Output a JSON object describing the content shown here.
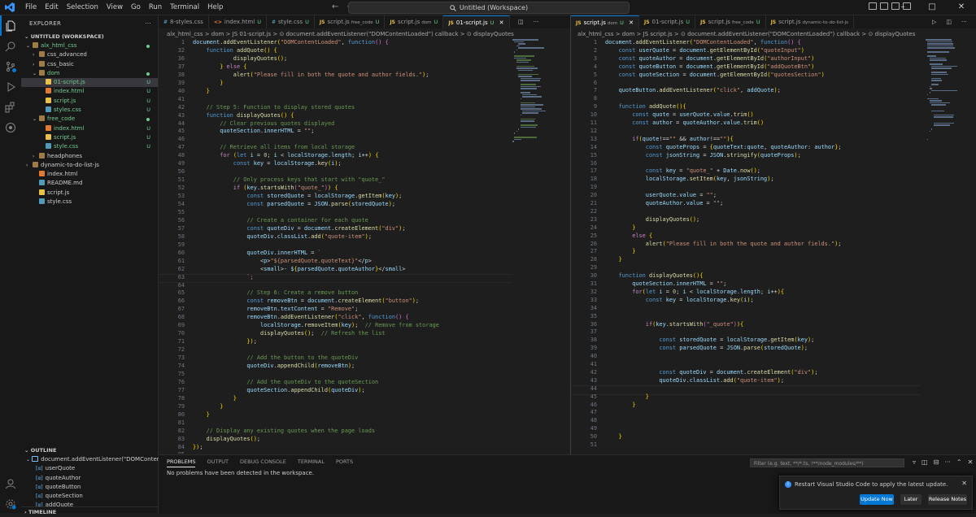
{
  "menu": [
    "File",
    "Edit",
    "Selection",
    "View",
    "Go",
    "Run",
    "Terminal",
    "Help"
  ],
  "search": {
    "text": "Untitled (Workspace)"
  },
  "explorer": {
    "title": "EXPLORER",
    "workspace": "UNTITLED (WORKSPACE)"
  },
  "tree": [
    {
      "label": "alx_html_css",
      "depth": 0,
      "kind": "folder-open",
      "status": "dot"
    },
    {
      "label": "css_advanced",
      "depth": 1,
      "kind": "folder",
      "status": ""
    },
    {
      "label": "css_basic",
      "depth": 1,
      "kind": "folder",
      "status": ""
    },
    {
      "label": "dom",
      "depth": 1,
      "kind": "folder-open",
      "status": "dot"
    },
    {
      "label": "01-script.js",
      "depth": 2,
      "kind": "js",
      "status": "U",
      "selected": true
    },
    {
      "label": "index.html",
      "depth": 2,
      "kind": "html",
      "status": "U"
    },
    {
      "label": "script.js",
      "depth": 2,
      "kind": "js",
      "status": "U"
    },
    {
      "label": "styles.css",
      "depth": 2,
      "kind": "css",
      "status": "U"
    },
    {
      "label": "free_code",
      "depth": 1,
      "kind": "folder-open",
      "status": "dot"
    },
    {
      "label": "index.html",
      "depth": 2,
      "kind": "html",
      "status": "U"
    },
    {
      "label": "script.js",
      "depth": 2,
      "kind": "js",
      "status": "U"
    },
    {
      "label": "style.css",
      "depth": 2,
      "kind": "css",
      "status": "U"
    },
    {
      "label": "headphones",
      "depth": 1,
      "kind": "folder",
      "status": ""
    },
    {
      "label": "dynamic-to-do-list-js",
      "depth": 0,
      "kind": "folder",
      "status": ""
    },
    {
      "label": "index.html",
      "depth": 1,
      "kind": "html",
      "status": ""
    },
    {
      "label": "README.md",
      "depth": 1,
      "kind": "md",
      "status": ""
    },
    {
      "label": "script.js",
      "depth": 1,
      "kind": "js",
      "status": ""
    },
    {
      "label": "style.css",
      "depth": 1,
      "kind": "css",
      "status": ""
    }
  ],
  "outline": {
    "title": "OUTLINE",
    "root": "document.addEventListener(\"DOMContentLoa...",
    "items": [
      "userQuote",
      "quoteAuthor",
      "quoteButton",
      "quoteSection",
      "addQuote"
    ]
  },
  "timeline": {
    "title": "TIMELINE"
  },
  "left_tabs": [
    {
      "icon": "#",
      "name": "8-styles.css",
      "dir": "",
      "status": ""
    },
    {
      "icon": "<>",
      "name": "index.html",
      "dir": "",
      "status": "U"
    },
    {
      "icon": "#",
      "name": "style.css",
      "dir": "",
      "status": "U"
    },
    {
      "icon": "JS",
      "name": "script.js",
      "dir": "free_code",
      "status": "U"
    },
    {
      "icon": "JS",
      "name": "script.js",
      "dir": "dom",
      "status": "U"
    },
    {
      "icon": "JS",
      "name": "01-script.js",
      "dir": "",
      "status": "U",
      "active": true
    }
  ],
  "right_tabs": [
    {
      "icon": "JS",
      "name": "script.js",
      "dir": "dom",
      "status": "U",
      "active": true
    },
    {
      "icon": "JS",
      "name": "01-script.js",
      "dir": "",
      "status": "U"
    },
    {
      "icon": "JS",
      "name": "script.js",
      "dir": "free_code",
      "status": "U"
    },
    {
      "icon": "JS",
      "name": "script.js",
      "dir": "dynamic-to-do-list-js",
      "status": ""
    }
  ],
  "left_crumbs": "alx_html_css > dom > JS 01-script.js > ⊙ document.addEventListener(\"DOMContentLoaded\") callback > ⊙ displayQuotes",
  "right_crumbs": "alx_html_css > dom > JS script.js > ⊙ document.addEventListener(\"DOMContentLoaded\") callback > ⊙ displayQuotes",
  "left_code": [
    [
      "1",
      "document.addEventListener(\"DOMContentLoaded\", function() {"
    ],
    [
      "32",
      "    function addQuote() {"
    ],
    [
      "36",
      "            displayQuotes();"
    ],
    [
      "37",
      "        } else {"
    ],
    [
      "38",
      "            alert(\"Please fill in both the quote and author fields.\");"
    ],
    [
      "39",
      "        }"
    ],
    [
      "40",
      "    }"
    ],
    [
      "41",
      ""
    ],
    [
      "42",
      "    // Step 5: Function to display stored quotes"
    ],
    [
      "43",
      "    function displayQuotes() {"
    ],
    [
      "44",
      "        // Clear previous quotes displayed"
    ],
    [
      "45",
      "        quoteSection.innerHTML = \"\";"
    ],
    [
      "46",
      ""
    ],
    [
      "47",
      "        // Retrieve all items from local storage"
    ],
    [
      "48",
      "        for (let i = 0; i < localStorage.length; i++) {"
    ],
    [
      "49",
      "            const key = localStorage.key(i);"
    ],
    [
      "50",
      ""
    ],
    [
      "51",
      "            // Only process keys that start with \"quote_\""
    ],
    [
      "52",
      "            if (key.startsWith(\"quote_\")) {"
    ],
    [
      "53",
      "                const storedQuote = localStorage.getItem(key);"
    ],
    [
      "54",
      "                const parsedQuote = JSON.parse(storedQuote);"
    ],
    [
      "55",
      ""
    ],
    [
      "56",
      "                // Create a container for each quote"
    ],
    [
      "57",
      "                const quoteDiv = document.createElement(\"div\");"
    ],
    [
      "58",
      "                quoteDiv.classList.add(\"quote-item\");"
    ],
    [
      "59",
      ""
    ],
    [
      "60",
      "                quoteDiv.innerHTML = `"
    ],
    [
      "61",
      "                    <p>\"${parsedQuote.quoteText}\"</p>"
    ],
    [
      "62",
      "                    <small>- ${parsedQuote.quoteAuthor}</small>"
    ],
    [
      "63",
      "                `;"
    ],
    [
      "64",
      ""
    ],
    [
      "65",
      "                // Step 6: Create a remove button"
    ],
    [
      "66",
      "                const removeBtn = document.createElement(\"button\");"
    ],
    [
      "67",
      "                removeBtn.textContent = \"Remove\";"
    ],
    [
      "68",
      "                removeBtn.addEventListener(\"click\", function() {"
    ],
    [
      "69",
      "                    localStorage.removeItem(key);  // Remove from storage"
    ],
    [
      "70",
      "                    displayQuotes();  // Refresh the list"
    ],
    [
      "71",
      "                });"
    ],
    [
      "72",
      ""
    ],
    [
      "73",
      "                // Add the button to the quoteDiv"
    ],
    [
      "74",
      "                quoteDiv.appendChild(removeBtn);"
    ],
    [
      "75",
      ""
    ],
    [
      "76",
      "                // Add the quoteDiv to the quoteSection"
    ],
    [
      "77",
      "                quoteSection.appendChild(quoteDiv);"
    ],
    [
      "78",
      "            }"
    ],
    [
      "79",
      "        }"
    ],
    [
      "80",
      "    }"
    ],
    [
      "81",
      ""
    ],
    [
      "82",
      "    // Display any existing quotes when the page loads"
    ],
    [
      "83",
      "    displayQuotes();"
    ],
    [
      "84",
      "});"
    ],
    [
      "85",
      ""
    ]
  ],
  "right_code": [
    [
      "1",
      "document.addEventListener(\"DOMContentLoaded\", function() {"
    ],
    [
      "2",
      "    const userQuote = document.getElementById(\"quoteInput\")"
    ],
    [
      "3",
      "    const quoteAuthor = document.getElementById(\"authorInput\")"
    ],
    [
      "4",
      "    const quoteButton = document.getElementById(\"addQuoteBtn\")"
    ],
    [
      "5",
      "    const quoteSection = document.getElementById(\"quotesSection\")"
    ],
    [
      "6",
      ""
    ],
    [
      "7",
      "    quoteButton.addEventListener(\"click\", addQuote);"
    ],
    [
      "8",
      ""
    ],
    [
      "9",
      "    function addQuote(){"
    ],
    [
      "10",
      "        const quote = userQuote.value.trim()"
    ],
    [
      "11",
      "        const author = quoteAuthor.value.trim()"
    ],
    [
      "12",
      ""
    ],
    [
      "13",
      "        if(quote!==\"\" && author!==\"\"){"
    ],
    [
      "14",
      "            const quoteProps = {quoteText:quote, quoteAuthor: author};"
    ],
    [
      "15",
      "            const jsonString = JSON.stringify(quoteProps);"
    ],
    [
      "16",
      ""
    ],
    [
      "17",
      "            const key = \"quote_\" + Date.now();"
    ],
    [
      "18",
      "            localStorage.setItem(key, jsonString);"
    ],
    [
      "19",
      ""
    ],
    [
      "20",
      "            userQuote.value = \"\";"
    ],
    [
      "21",
      "            quoteAuthor.value = \"\";"
    ],
    [
      "22",
      ""
    ],
    [
      "23",
      "            displayQuotes();"
    ],
    [
      "24",
      "        }"
    ],
    [
      "25",
      "        else {"
    ],
    [
      "26",
      "            alert(\"Please fill in both the quote and author fields.\");"
    ],
    [
      "27",
      "        }"
    ],
    [
      "28",
      "    }"
    ],
    [
      "29",
      ""
    ],
    [
      "30",
      "    function displayQuotes(){"
    ],
    [
      "31",
      "        quoteSection.innerHTML = \"\";"
    ],
    [
      "32",
      "        for(let i = 0; i < localStorage.length; i++){"
    ],
    [
      "33",
      "            const key = localStorage.key(i);"
    ],
    [
      "34",
      ""
    ],
    [
      "35",
      ""
    ],
    [
      "36",
      "            if(key.startsWith(\"_quote\")){"
    ],
    [
      "37",
      ""
    ],
    [
      "38",
      "                const storedQuote = localStorage.getItem(key);"
    ],
    [
      "39",
      "                const parsedQuote = JSON.parse(storedQuote);"
    ],
    [
      "40",
      ""
    ],
    [
      "41",
      ""
    ],
    [
      "42",
      "                const quoteDiv = document.createElement(\"div\");"
    ],
    [
      "43",
      "                quoteDiv.classList.add(\"quote-item\");"
    ],
    [
      "44",
      ""
    ],
    [
      "45",
      "            }"
    ],
    [
      "46",
      "        }"
    ],
    [
      "47",
      ""
    ],
    [
      "48",
      ""
    ],
    [
      "49",
      ""
    ],
    [
      "50",
      "    }"
    ],
    [
      "51",
      ""
    ]
  ],
  "panel": {
    "tabs": [
      "PROBLEMS",
      "OUTPUT",
      "DEBUG CONSOLE",
      "TERMINAL",
      "PORTS"
    ],
    "message": "No problems have been detected in the workspace.",
    "filter_placeholder": "Filter (e.g. text, **/*.ts, !**/node_modules/**)"
  },
  "notification": {
    "message": "Restart Visual Studio Code to apply the latest update.",
    "primary": "Update Now",
    "secondary": "Later",
    "tertiary": "Release Notes"
  },
  "colors": {
    "accent": "#0078d4",
    "untracked": "#73c991",
    "js": "#e8c04b",
    "html": "#e37933",
    "css": "#519aba"
  }
}
